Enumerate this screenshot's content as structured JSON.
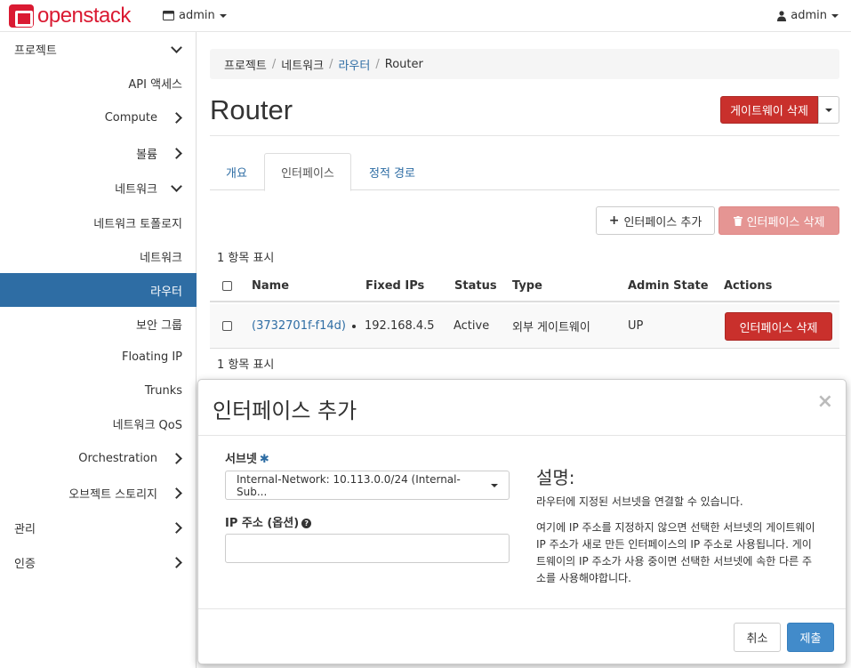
{
  "brand": {
    "name": "openstack",
    "color": "#da1a32"
  },
  "topbar": {
    "project": "admin",
    "user": "admin",
    "project_icon": "project-icon",
    "user_icon": "user-icon"
  },
  "sidebar": {
    "project": "프로젝트",
    "items": [
      "API 액세스",
      "Compute",
      "볼륨",
      "네트워크",
      "네트워크 토폴로지",
      "네트워크",
      "라우터",
      "보안 그룹",
      "Floating IP",
      "Trunks",
      "네트워크 QoS",
      "Orchestration",
      "오브젝트 스토리지"
    ],
    "admin": "관리",
    "identity": "인증"
  },
  "breadcrumb": {
    "items": [
      "프로젝트",
      "네트워크",
      "라우터",
      "Router"
    ]
  },
  "page": {
    "title": "Router",
    "delete_gateway": "게이트웨이 삭제"
  },
  "tabs": [
    "개요",
    "인터페이스",
    "정적 경로"
  ],
  "actions": {
    "add_interface": "인터페이스 추가",
    "delete_interfaces": "인터페이스 삭제"
  },
  "table": {
    "count_label": "1 항목 표시",
    "headers": {
      "name": "Name",
      "fixed_ips": "Fixed IPs",
      "status": "Status",
      "type": "Type",
      "admin_state": "Admin State",
      "actions": "Actions"
    },
    "rows": [
      {
        "name": "(3732701f-f14d)",
        "fixed_ip": "192.168.4.5",
        "status": "Active",
        "type": "외부 게이트웨이",
        "admin_state": "UP",
        "action": "인터페이스 삭제"
      }
    ]
  },
  "modal": {
    "title": "인터페이스 추가",
    "close": "×",
    "subnet_label": "서브넷",
    "required_mark": "✱",
    "subnet_value": "Internal-Network: 10.113.0.0/24 (Internal-Sub...",
    "ip_label": "IP 주소 (옵션)",
    "ip_value": "",
    "desc_title": "설명:",
    "desc_p1": "라우터에 지정된 서브넷을 연결할 수 있습니다.",
    "desc_p2": "여기에 IP 주소를 지정하지 않으면 선택한 서브넷의 게이트웨이 IP 주소가 새로 만든 인터페이스의 IP 주소로 사용됩니다. 게이트웨이의 IP 주소가 사용 중이면 선택한 서브넷에 속한 다른 주소를 사용해야합니다.",
    "cancel": "취소",
    "submit": "제출"
  },
  "colors": {
    "active_nav": "#2e6da4",
    "danger": "#c9302c",
    "primary": "#428bca",
    "link": "#2e6da4"
  }
}
